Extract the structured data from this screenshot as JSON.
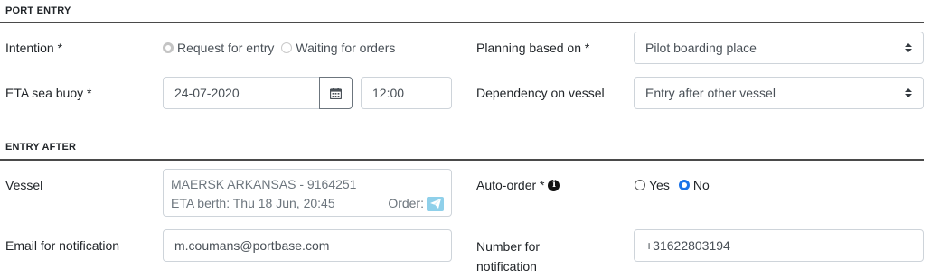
{
  "port_entry": {
    "section_title": "PORT ENTRY",
    "intention": {
      "label": "Intention *",
      "options": [
        "Request for entry",
        "Waiting for orders"
      ],
      "selected": "Request for entry"
    },
    "planning_based_on": {
      "label": "Planning based on *",
      "value": "Pilot boarding place"
    },
    "eta_sea_buoy": {
      "label": "ETA sea buoy *",
      "date": "24-07-2020",
      "time": "12:00"
    },
    "dependency_on_vessel": {
      "label": "Dependency on vessel",
      "value": "Entry after other vessel"
    }
  },
  "entry_after": {
    "section_title": "ENTRY AFTER",
    "vessel": {
      "label": "Vessel",
      "name": "MAERSK ARKANSAS - 9164251",
      "eta_berth": "ETA berth: Thu 18 Jun, 20:45",
      "order_label": "Order:"
    },
    "auto_order": {
      "label": "Auto-order *",
      "options": [
        "Yes",
        "No"
      ],
      "selected": "No"
    },
    "email_for_notification": {
      "label": "Email for notification",
      "value": "m.coumans@portbase.com"
    },
    "number_for_notification": {
      "label_line1": "Number for",
      "label_line2": "notification",
      "value": "+31622803194"
    }
  },
  "icons": {
    "calendar": "calendar-icon",
    "info": "info-icon",
    "order": "paper-plane-icon",
    "select_caret": "chevron-up-down-icon"
  },
  "colors": {
    "accent": "#1a73e8",
    "order_icon_bg": "#8fd0ea",
    "rule": "#4a4a4a"
  }
}
